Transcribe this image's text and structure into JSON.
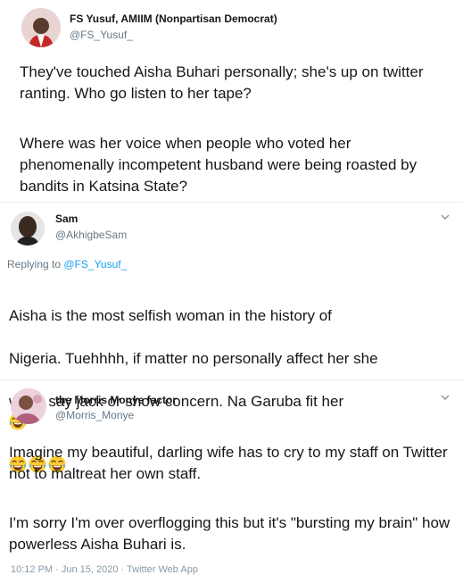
{
  "tweet1": {
    "name": "FS Yusuf, AMIIM (Nonpartisan Democrat)",
    "handle": "@FS_Yusuf_",
    "body_p1": "They've touched Aisha Buhari personally; she's up on twitter ranting. Who go listen to her tape?",
    "body_p2": "Where was her voice when people who voted her phenomenally incompetent husband were being roasted by bandits in Katsina State?"
  },
  "tweet2": {
    "name": "Sam",
    "handle": "@AkhigbeSam",
    "replying_prefix": "Replying to",
    "replying_to": "@FS_Yusuf_",
    "body_line1": "Aisha is the most selfish woman in the history of",
    "body_line2": "Nigeria. Tuehhhh, if matter no personally affect her she",
    "body_line3": "won’t say jack or show concern. Na Garuba fit her",
    "emoji": "face-with-tears-of-joy"
  },
  "tweet3": {
    "name": "the Morris Monye factor",
    "handle": "@Morris_Monye",
    "body_p1": "Imagine my beautiful, darling wife has to cry to my staff on Twitter not to maltreat her own staff.",
    "body_p2": "I'm sorry I'm over overflogging this but it's \"bursting my brain\" how powerless Aisha Buhari is."
  },
  "footer": "10:12 PM · Jun 15, 2020 · Twitter Web App",
  "colors": {
    "link": "#1da1f2",
    "muted": "#657786",
    "divider": "#e6ecf0"
  }
}
